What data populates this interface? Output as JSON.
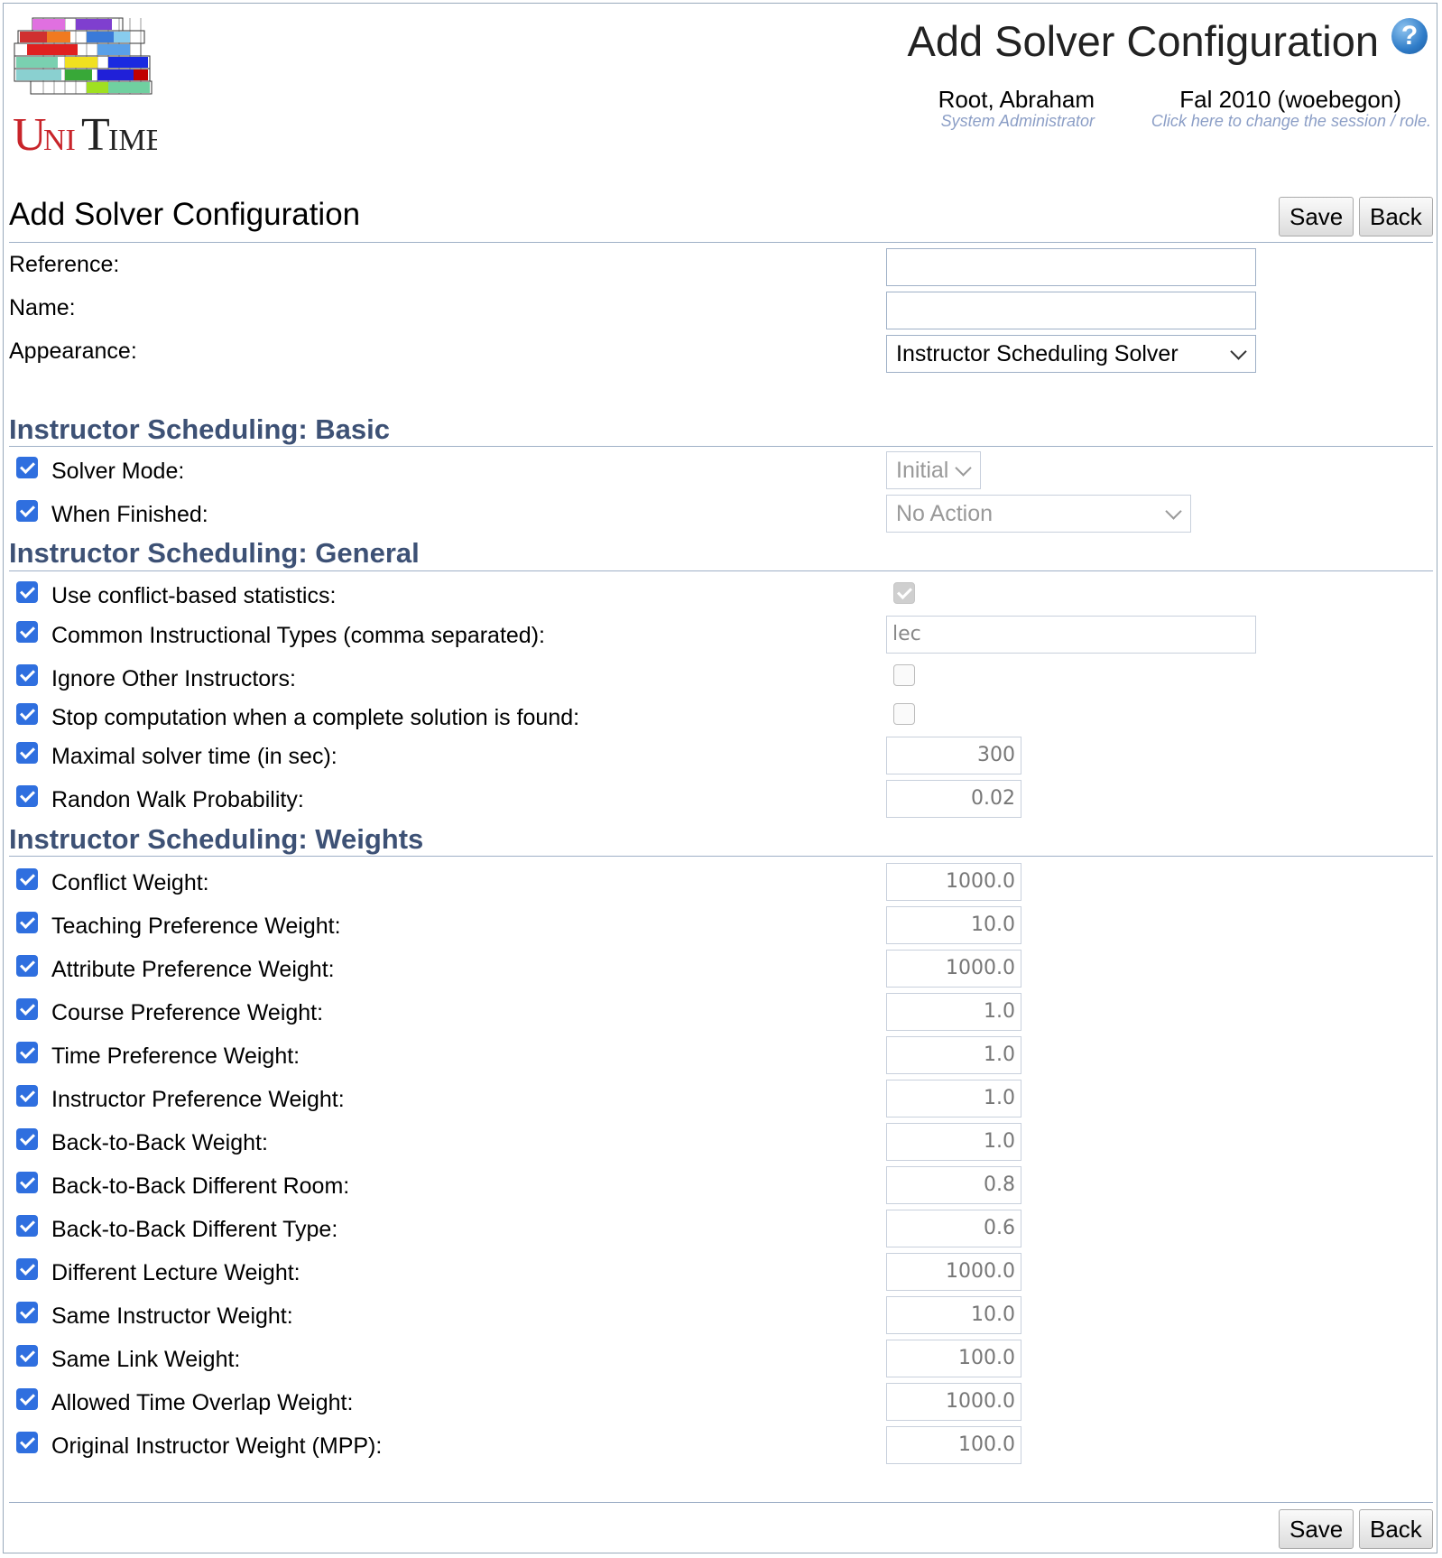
{
  "header": {
    "logo_text": "UniTime",
    "title": "Add Solver Configuration",
    "help_icon": "?",
    "user": {
      "name": "Root, Abraham",
      "role": "System Administrator"
    },
    "session": {
      "name": "Fal 2010 (woebegon)",
      "hint": "Click here to change the session / role."
    }
  },
  "main": {
    "title": "Add Solver Configuration",
    "save_label": "Save",
    "back_label": "Back",
    "reference_label": "Reference:",
    "reference_value": "",
    "name_label": "Name:",
    "name_value": "",
    "appearance_label": "Appearance:",
    "appearance_value": "Instructor Scheduling Solver"
  },
  "basic": {
    "title": "Instructor Scheduling: Basic",
    "solver_mode_label": "Solver Mode:",
    "solver_mode_value": "Initial",
    "when_finished_label": "When Finished:",
    "when_finished_value": "No Action"
  },
  "general": {
    "title": "Instructor Scheduling: General",
    "conflict_stats_label": "Use conflict-based statistics:",
    "conflict_stats_checked": true,
    "common_types_label": "Common Instructional Types (comma separated):",
    "common_types_value": "lec",
    "ignore_other_label": "Ignore Other Instructors:",
    "ignore_other_checked": false,
    "stop_label": "Stop computation when a complete solution is found:",
    "stop_checked": false,
    "max_time_label": "Maximal solver time (in sec):",
    "max_time_value": "300",
    "random_walk_label": "Randon Walk Probability:",
    "random_walk_value": "0.02"
  },
  "weights": {
    "title": "Instructor Scheduling: Weights",
    "rows": [
      {
        "label": "Conflict Weight:",
        "value": "1000.0"
      },
      {
        "label": "Teaching Preference Weight:",
        "value": "10.0"
      },
      {
        "label": "Attribute Preference Weight:",
        "value": "1000.0"
      },
      {
        "label": "Course Preference Weight:",
        "value": "1.0"
      },
      {
        "label": "Time Preference Weight:",
        "value": "1.0"
      },
      {
        "label": "Instructor Preference Weight:",
        "value": "1.0"
      },
      {
        "label": "Back-to-Back Weight:",
        "value": "1.0"
      },
      {
        "label": "Back-to-Back Different Room:",
        "value": "0.8"
      },
      {
        "label": "Back-to-Back Different Type:",
        "value": "0.6"
      },
      {
        "label": "Different Lecture Weight:",
        "value": "1000.0"
      },
      {
        "label": "Same Instructor Weight:",
        "value": "10.0"
      },
      {
        "label": "Same Link Weight:",
        "value": "100.0"
      },
      {
        "label": "Allowed Time Overlap Weight:",
        "value": "1000.0"
      },
      {
        "label": "Original Instructor Weight (MPP):",
        "value": "100.0"
      }
    ]
  },
  "colors": {
    "section_title": "#3d5175",
    "checkbox": "#2f6fdf",
    "divider": "#9fb0c7"
  }
}
